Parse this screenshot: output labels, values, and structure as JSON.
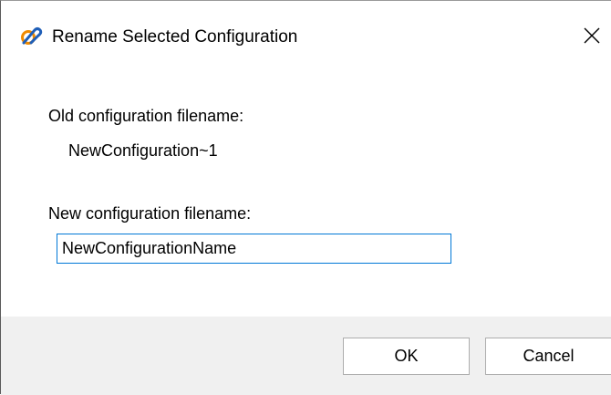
{
  "dialog": {
    "title": "Rename Selected Configuration",
    "app_icon": "config-app-icon",
    "close_icon": "close-icon"
  },
  "form": {
    "old_label": "Old configuration filename:",
    "old_value": "NewConfiguration~1",
    "new_label": "New configuration filename:",
    "new_value": "NewConfigurationName"
  },
  "buttons": {
    "ok_label": "OK",
    "cancel_label": "Cancel"
  },
  "colors": {
    "input_border": "#0078d7",
    "footer_bg": "#f0f0f0",
    "button_border": "#adadad",
    "icon_orange": "#f08a00",
    "icon_blue": "#1f5fb8"
  }
}
